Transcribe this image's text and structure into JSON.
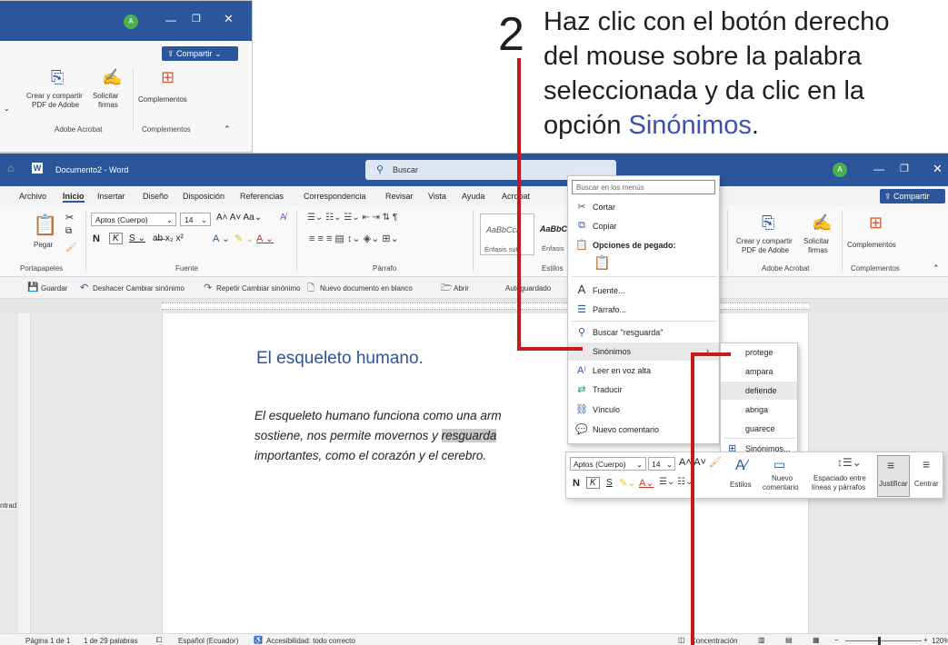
{
  "instruction": {
    "number": "2",
    "line1": "Haz clic con el botón derecho",
    "line2": "del mouse sobre la palabra",
    "line3": "seleccionada y da clic en la",
    "line4_prefix": "opción ",
    "line4_emph": "Sinónimos",
    "line4_suffix": "."
  },
  "back_window": {
    "share_label": "Compartir",
    "avatar_letter": "A",
    "create_pdf_line1": "Crear y compartir",
    "create_pdf_line2": "PDF de Adobe",
    "request_sign_line1": "Solicitar",
    "request_sign_line2": "firmas",
    "addins_label": "Complementos",
    "group_acrobat": "Adobe Acrobat",
    "group_addins": "Complementos"
  },
  "window": {
    "title": "Documento2 - Word",
    "search_placeholder": "Buscar",
    "avatar_letter": "A",
    "share_label": "Compartir"
  },
  "menu": {
    "items": [
      "Archivo",
      "Inicio",
      "Insertar",
      "Diseño",
      "Disposición",
      "Referencias",
      "Correspondencia",
      "Revisar",
      "Vista",
      "Ayuda",
      "Acrobat"
    ],
    "active": "Inicio"
  },
  "ribbon": {
    "paste_label": "Pegar",
    "font_name": "Aptos (Cuerpo)",
    "font_size": "14",
    "group_clipboard": "Portapapeles",
    "group_font": "Fuente",
    "group_paragraph": "Párrafo",
    "group_styles": "Estilos",
    "style1": "AaBbCcL",
    "style1_name": "Énfasis sutil",
    "style2": "AaBbCc",
    "style2_name": "Énfasis",
    "create_pdf_line1": "Crear y compartir",
    "create_pdf_line2": "PDF de Adobe",
    "request_sign_line1": "Solicitar",
    "request_sign_line2": "firmas",
    "addins_label": "Complementos",
    "group_acrobat": "Adobe Acrobat",
    "group_addins": "Complementos"
  },
  "qat": {
    "save": "Guardar",
    "undo": "Deshacer Cambiar sinónimo",
    "redo": "Repetir Cambiar sinónimo",
    "new_blank": "Nuevo documento en blanco",
    "open": "Abrir",
    "autosave": "Autoguardado"
  },
  "document": {
    "heading": "El esqueleto humano.",
    "line1": "El esqueleto humano funciona como una arm",
    "line2_pre": "sostiene, nos permite movernos y ",
    "line2_selected": "resguarda",
    "line3": "importantes, como el corazón y el cerebro."
  },
  "context_menu": {
    "search_placeholder": "Buscar en los menús",
    "cut": "Cortar",
    "copy": "Copiar",
    "paste_options": "Opciones de pegado:",
    "font": "Fuente...",
    "paragraph": "Párrafo...",
    "lookup": "Buscar \"resguarda\"",
    "synonyms": "Sinónimos",
    "read_aloud": "Leer en voz alta",
    "translate": "Traducir",
    "link": "Vínculo",
    "new_comment": "Nuevo comentario"
  },
  "synonyms_submenu": {
    "items": [
      "protege",
      "ampara",
      "defiende",
      "abriga",
      "guarece"
    ],
    "more": "Sinónimos..."
  },
  "mini_toolbar": {
    "font_name": "Aptos (Cuerpo)",
    "font_size": "14",
    "styles": "Estilos",
    "new_comment_line1": "Nuevo",
    "new_comment_line2": "comentario",
    "spacing_line1": "Espaciado entre",
    "spacing_line2": "líneas y párrafos",
    "justify": "Justificar",
    "center": "Centrar"
  },
  "status_bar": {
    "page": "Página 1 de 1",
    "words": "1 de 29 palabras",
    "language": "Español (Ecuador)",
    "accessibility": "Accesibilidad: todo correcto",
    "focus": "Concentración",
    "zoom": "120%"
  },
  "left_fragments": {
    "frag1": "s",
    "frag2": "s",
    "frag3": "ntrad"
  }
}
